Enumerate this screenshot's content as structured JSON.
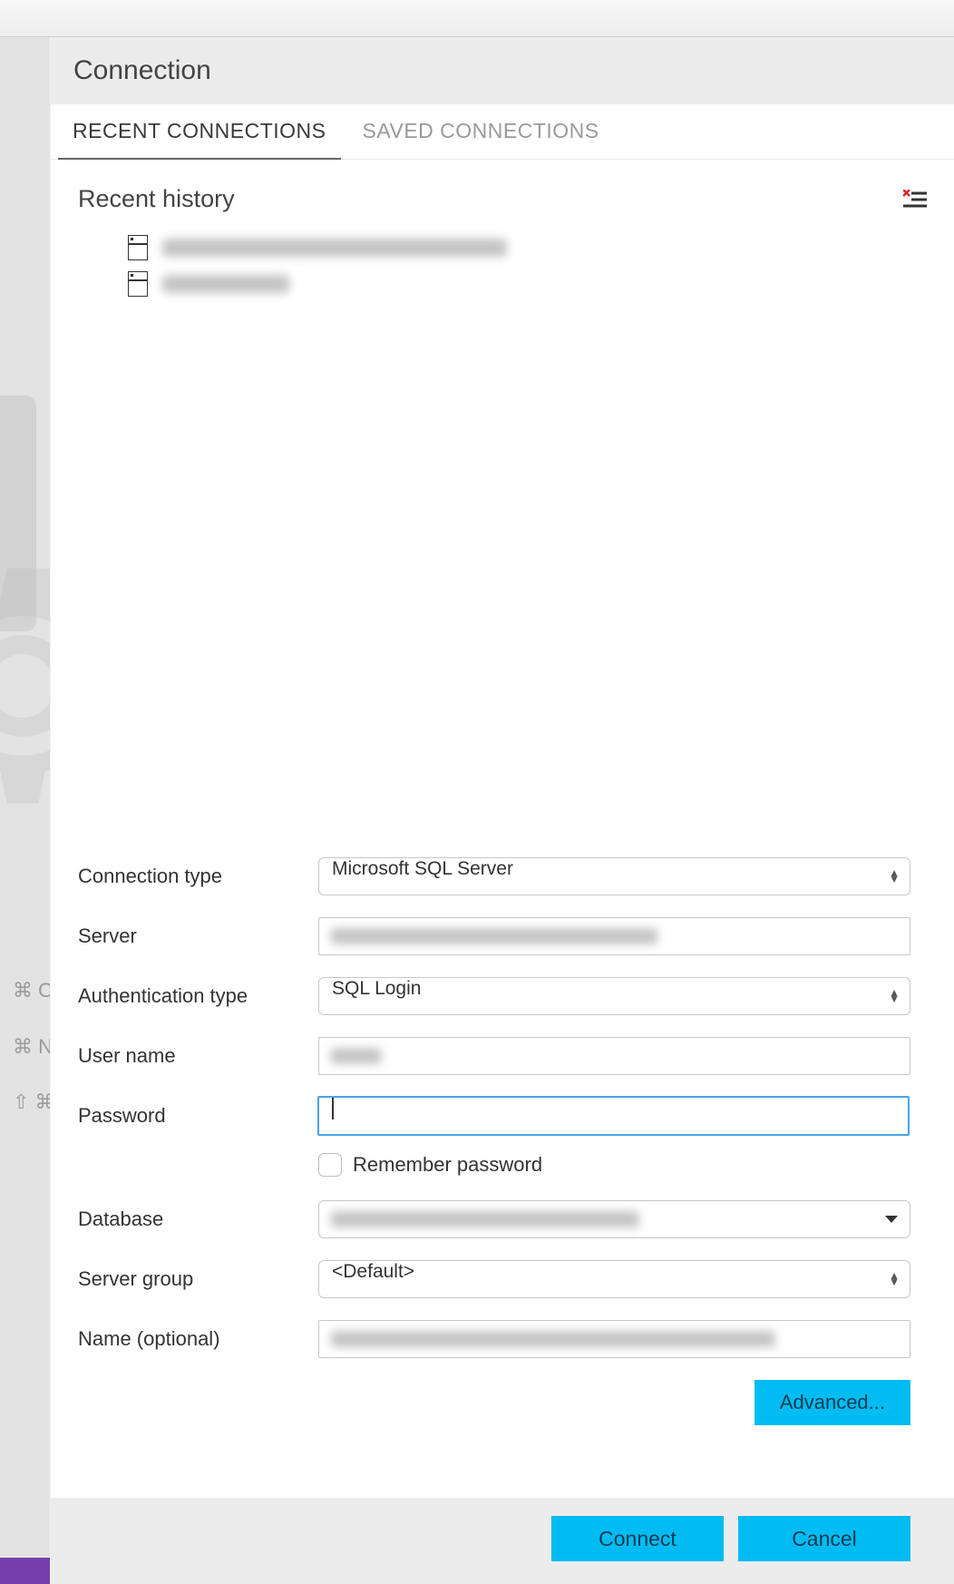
{
  "header": {
    "title": "Connection"
  },
  "tabs": {
    "recent": "RECENT CONNECTIONS",
    "saved": "SAVED CONNECTIONS"
  },
  "history": {
    "title": "Recent history",
    "items": [
      {
        "label": ""
      },
      {
        "label": ""
      }
    ]
  },
  "form": {
    "connection_type": {
      "label": "Connection type",
      "value": "Microsoft SQL Server"
    },
    "server": {
      "label": "Server",
      "value": ""
    },
    "auth_type": {
      "label": "Authentication type",
      "value": "SQL Login"
    },
    "username": {
      "label": "User name",
      "value": ""
    },
    "password": {
      "label": "Password",
      "value": ""
    },
    "remember": {
      "label": "Remember password",
      "checked": false
    },
    "database": {
      "label": "Database",
      "value": ""
    },
    "server_group": {
      "label": "Server group",
      "value": "<Default>"
    },
    "name": {
      "label": "Name (optional)",
      "value": ""
    }
  },
  "buttons": {
    "advanced": "Advanced...",
    "connect": "Connect",
    "cancel": "Cancel"
  },
  "bg_shortcuts": {
    "l1": "⌘ O",
    "l2": "⌘ N",
    "l3": "⇧ ⌘"
  }
}
